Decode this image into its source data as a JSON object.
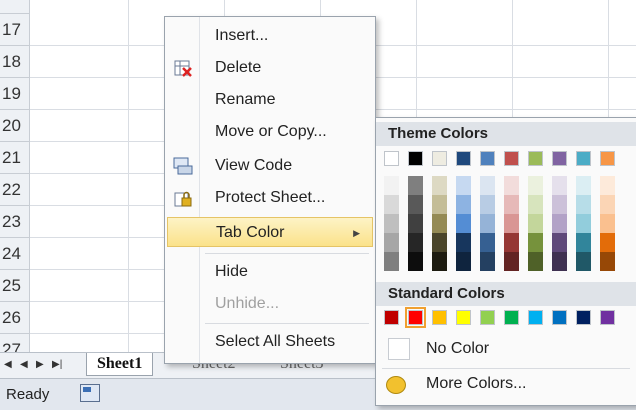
{
  "row_numbers": [
    "17",
    "18",
    "19",
    "20",
    "21",
    "22",
    "23",
    "24",
    "25",
    "26",
    "27"
  ],
  "sheet_tabs": {
    "nav_labels": [
      "◂",
      "◂",
      "▸",
      "▸|"
    ],
    "tabs": [
      {
        "label": "Sheet1",
        "active": true
      },
      {
        "label": "Sheet2",
        "active": false
      },
      {
        "label": "Sheet3",
        "active": false
      }
    ]
  },
  "status_bar": {
    "status_text": "Ready"
  },
  "context_menu": {
    "items": [
      {
        "label": "Insert...",
        "icon": "insert",
        "disabled": false
      },
      {
        "label": "Delete",
        "icon": "delete-icon",
        "disabled": false
      },
      {
        "label": "Rename",
        "icon": "",
        "disabled": false
      },
      {
        "label": "Move or Copy...",
        "icon": "",
        "disabled": false
      },
      {
        "label": "View Code",
        "icon": "view-code-icon",
        "disabled": false
      },
      {
        "label": "Protect Sheet...",
        "icon": "protect-sheet-icon",
        "disabled": false
      },
      {
        "label": "Tab Color",
        "icon": "",
        "disabled": false,
        "highlighted": true,
        "submenu_arrow": "▶"
      },
      {
        "label": "Hide",
        "icon": "",
        "disabled": false
      },
      {
        "label": "Unhide...",
        "icon": "",
        "disabled": true
      },
      {
        "label": "Select All Sheets",
        "icon": "",
        "disabled": false
      }
    ]
  },
  "tab_color_submenu": {
    "theme_colors_label": "Theme Colors",
    "standard_colors_label": "Standard Colors",
    "no_color_label": "No Color",
    "more_colors_label": "More Colors...",
    "theme_top": [
      "#ffffff",
      "#000000",
      "#eeece1",
      "#1f497d",
      "#4f81bd",
      "#c0504d",
      "#9bbb59",
      "#8064a2",
      "#4bacc6",
      "#f79646"
    ],
    "theme_shades": [
      [
        "#f2f2f2",
        "#d9d9d9",
        "#bfbfbf",
        "#a6a6a6",
        "#7f7f7f"
      ],
      [
        "#7f7f7f",
        "#595959",
        "#404040",
        "#262626",
        "#0d0d0d"
      ],
      [
        "#ddd9c3",
        "#c4bd97",
        "#948a54",
        "#4a452a",
        "#1d1b10"
      ],
      [
        "#c6d9f1",
        "#8db3e2",
        "#548dd4",
        "#17365d",
        "#0f243e"
      ],
      [
        "#dbe5f1",
        "#b8cce4",
        "#95b3d7",
        "#366092",
        "#244061"
      ],
      [
        "#f2dcdb",
        "#e6b9b8",
        "#d99694",
        "#953734",
        "#632423"
      ],
      [
        "#ebf1de",
        "#d7e4bd",
        "#c3d69b",
        "#76923c",
        "#4f6128"
      ],
      [
        "#e5e0ec",
        "#ccc1d9",
        "#b2a2c7",
        "#5f497a",
        "#3f3151"
      ],
      [
        "#dbeef3",
        "#b7dde8",
        "#92cddc",
        "#31859b",
        "#205867"
      ],
      [
        "#fdeada",
        "#fbd5b5",
        "#fac08f",
        "#e36c09",
        "#974806"
      ]
    ],
    "standard": [
      "#c00000",
      "#ff0000",
      "#ffc000",
      "#ffff00",
      "#92d050",
      "#00b050",
      "#00b0f0",
      "#0070c0",
      "#002060",
      "#7030a0"
    ]
  }
}
